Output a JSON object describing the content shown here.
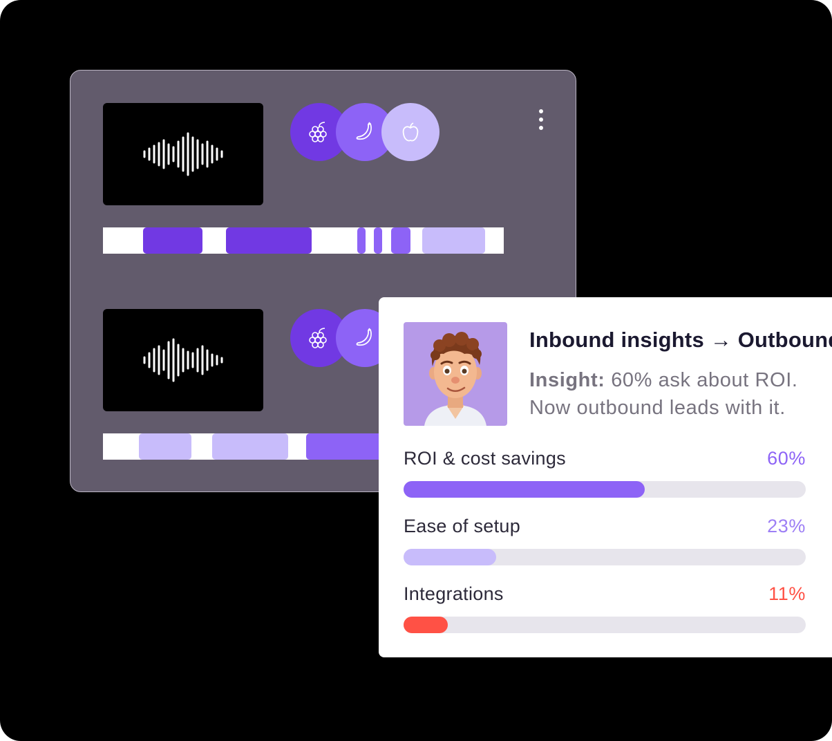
{
  "colors": {
    "purple_dark": "#7139e3",
    "purple_mid": "#8d63f6",
    "purple_light": "#c8bcfb",
    "red": "#ff5145",
    "track_bg": "#e7e5ec"
  },
  "calls": [
    {
      "thumbnail_icon": "audio-waveform-icon",
      "participants": [
        {
          "icon": "raspberry-icon",
          "color": "#7139e3"
        },
        {
          "icon": "banana-icon",
          "color": "#8d63f6"
        },
        {
          "icon": "apple-icon",
          "color": "#c8bcfb"
        }
      ],
      "menu_icon": "more-vertical-icon"
    },
    {
      "thumbnail_icon": "audio-waveform-icon",
      "participants": [
        {
          "icon": "raspberry-icon",
          "color": "#7139e3"
        },
        {
          "icon": "banana-icon",
          "color": "#8d63f6"
        }
      ]
    }
  ],
  "insight_card": {
    "title": "Inbound insights → Outbound",
    "insight_label": "Insight:",
    "insight_text": "60% ask about ROI. Now outbound leads with it.",
    "metrics": [
      {
        "label": "ROI & cost savings",
        "value_text": "60%",
        "percent": 60,
        "color": "#8d63f6"
      },
      {
        "label": "Ease of setup",
        "value_text": "23%",
        "percent": 23,
        "color": "#c8bcfb"
      },
      {
        "label": "Integrations",
        "value_text": "11%",
        "percent": 11,
        "color": "#ff5145"
      }
    ]
  }
}
